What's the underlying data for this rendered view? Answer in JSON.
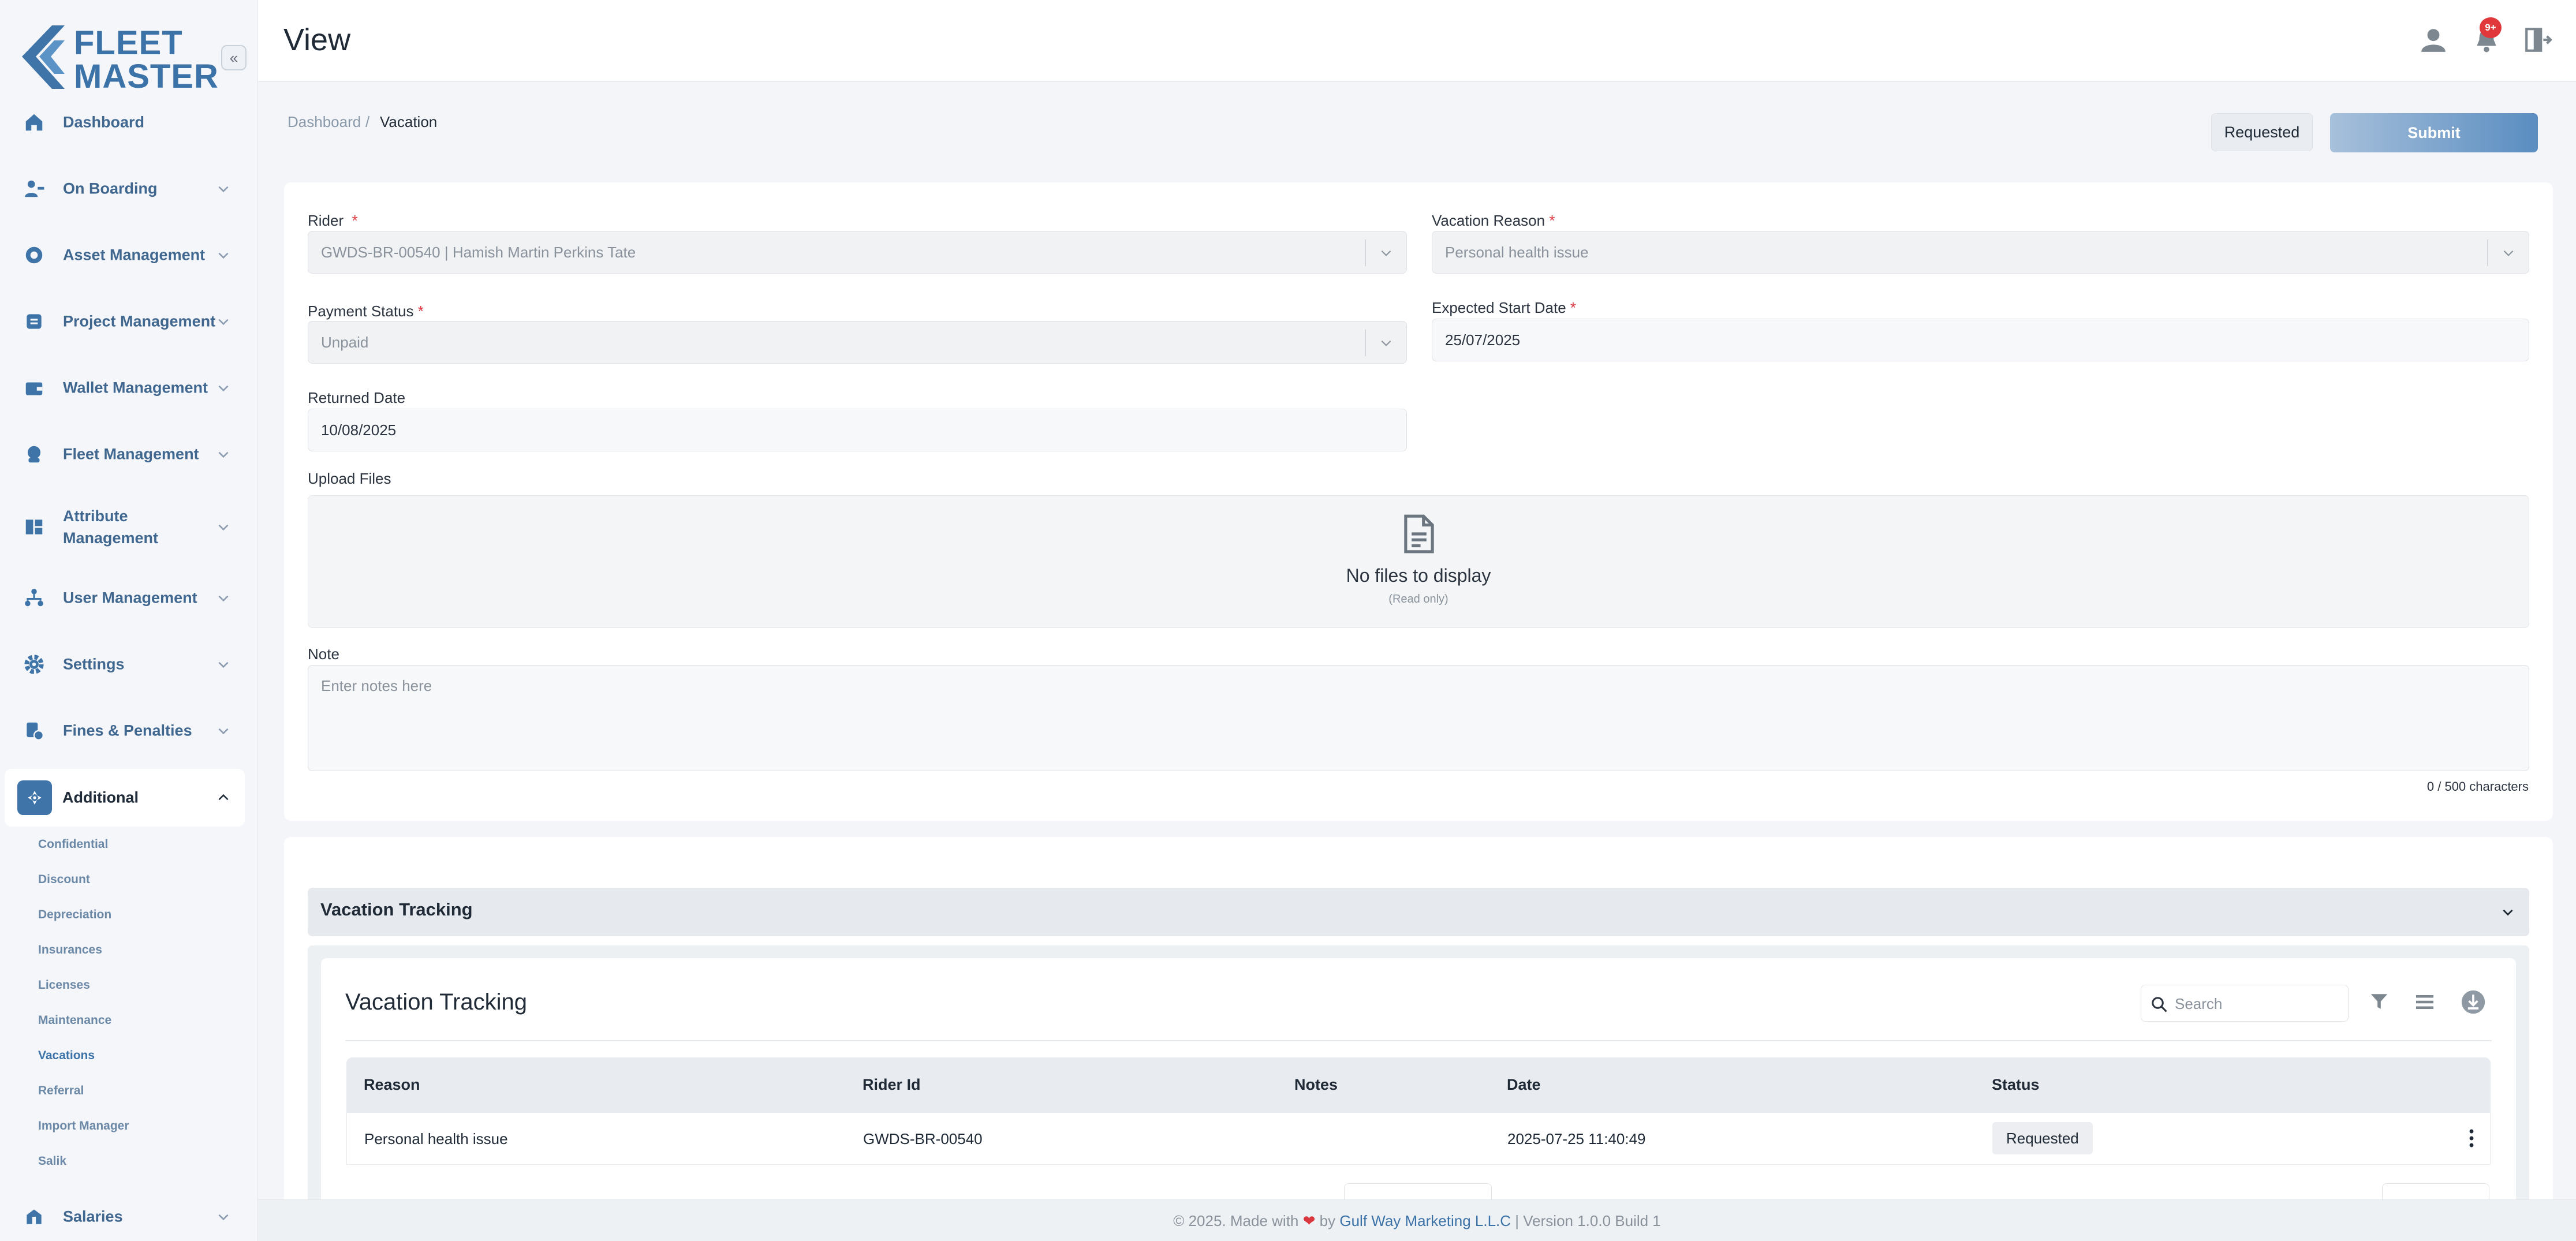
{
  "brand": {
    "line1": "FLEET",
    "line2": "MASTER",
    "accent": "#3e74a8"
  },
  "sidebar": {
    "collapse_glyph": "«",
    "items": [
      {
        "label": "Dashboard",
        "icon": "home-icon"
      },
      {
        "label": "On Boarding",
        "icon": "user-onboarding-icon"
      },
      {
        "label": "Asset Management",
        "icon": "asset-icon"
      },
      {
        "label": "Project Management",
        "icon": "project-icon"
      },
      {
        "label": "Wallet Management",
        "icon": "wallet-icon"
      },
      {
        "label": "Fleet Management",
        "icon": "fleet-icon"
      },
      {
        "label": "Attribute Management",
        "icon": "attribute-icon"
      },
      {
        "label": "User Management",
        "icon": "users-icon"
      },
      {
        "label": "Settings",
        "icon": "gear-icon"
      },
      {
        "label": "Fines & Penalties",
        "icon": "fines-icon"
      },
      {
        "label": "Additional",
        "icon": "additional-icon"
      },
      {
        "label": "Salaries",
        "icon": "salaries-icon"
      }
    ],
    "sub_items": [
      "Confidential",
      "Discount",
      "Depreciation",
      "Insurances",
      "Licenses",
      "Maintenance",
      "Vacations",
      "Referral",
      "Import Manager",
      "Salik"
    ]
  },
  "header": {
    "title": "View",
    "notification_count": "9+"
  },
  "breadcrumb": {
    "home": "Dashboard",
    "sep": "/",
    "current": "Vacation"
  },
  "actions": {
    "status": "Requested",
    "submit": "Submit"
  },
  "form": {
    "rider": {
      "label": "Rider",
      "required": "*",
      "value": "GWDS-BR-00540 | Hamish Martin Perkins Tate"
    },
    "vacation_reason": {
      "label": "Vacation Reason",
      "required": "*",
      "value": "Personal health issue"
    },
    "payment_status": {
      "label": "Payment Status",
      "required": "*",
      "value": "Unpaid"
    },
    "expected_start": {
      "label": "Expected Start Date",
      "required": "*",
      "value": "25/07/2025"
    },
    "returned_date": {
      "label": "Returned Date",
      "value": "10/08/2025"
    },
    "upload": {
      "label": "Upload Files",
      "empty": "No files to display",
      "hint": "(Read only)"
    },
    "note": {
      "label": "Note",
      "placeholder": "Enter notes here",
      "counter": "0 / 500 characters"
    }
  },
  "tracking": {
    "accordion_title": "Vacation Tracking",
    "table_title": "Vacation Tracking",
    "search_placeholder": "Search",
    "columns": [
      "Reason",
      "Rider Id",
      "Notes",
      "Date",
      "Status"
    ],
    "rows": [
      {
        "reason": "Personal health issue",
        "rider_id": "GWDS-BR-00540",
        "notes": "",
        "date": "2025-07-25 11:40:49",
        "status": "Requested"
      }
    ]
  },
  "footer": {
    "prefix": "© 2025. Made with",
    "by": "by",
    "company": "Gulf Way Marketing L.L.C",
    "version": "| Version 1.0.0 Build 1"
  }
}
